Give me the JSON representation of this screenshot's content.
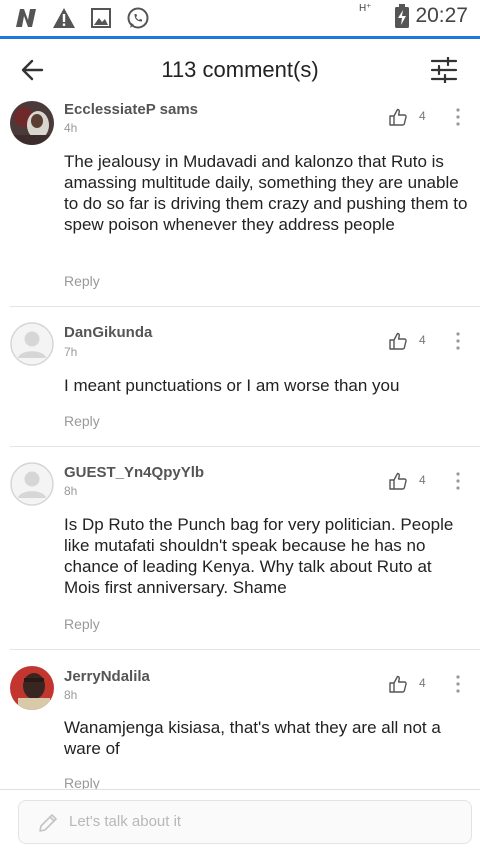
{
  "status_bar": {
    "icons": [
      "notification-n-icon",
      "warning-icon",
      "image-icon",
      "whatsapp-icon"
    ],
    "network": "H⁺",
    "time": "20:27"
  },
  "header": {
    "title": "113 comment(s)",
    "back_icon": "back-arrow-icon",
    "filter_icon": "sliders-icon"
  },
  "comments": [
    {
      "author": "EcclessiateP sams",
      "time": "4h",
      "likes": "4",
      "text": "The jealousy in Mudavadi and kalonzo that Ruto is amassing multitude daily, something they are unable to do so far is driving them crazy and pushing them to spew poison whenever they address people",
      "reply": "Reply"
    },
    {
      "author": "DanGikunda",
      "time": "7h",
      "likes": "4",
      "text": "I meant punctuations or I am worse than you",
      "reply": "Reply"
    },
    {
      "author": "GUEST_Yn4QpyYlb",
      "time": "8h",
      "likes": "4",
      "text": "Is Dp Ruto the Punch bag for very politician. People like mutafati shouldn't speak because he has no chance of leading Kenya. Why talk about Ruto at Mois first anniversary. Shame",
      "reply": "Reply"
    },
    {
      "author": "JerryNdalila",
      "time": "8h",
      "likes": "4",
      "text": "Wanamjenga kisiasa, that's what they are all not a ware of",
      "reply": "Reply"
    }
  ],
  "composer": {
    "placeholder": "Let's talk about it",
    "icon": "pencil-icon"
  },
  "colors": {
    "accent": "#1e78d8"
  }
}
